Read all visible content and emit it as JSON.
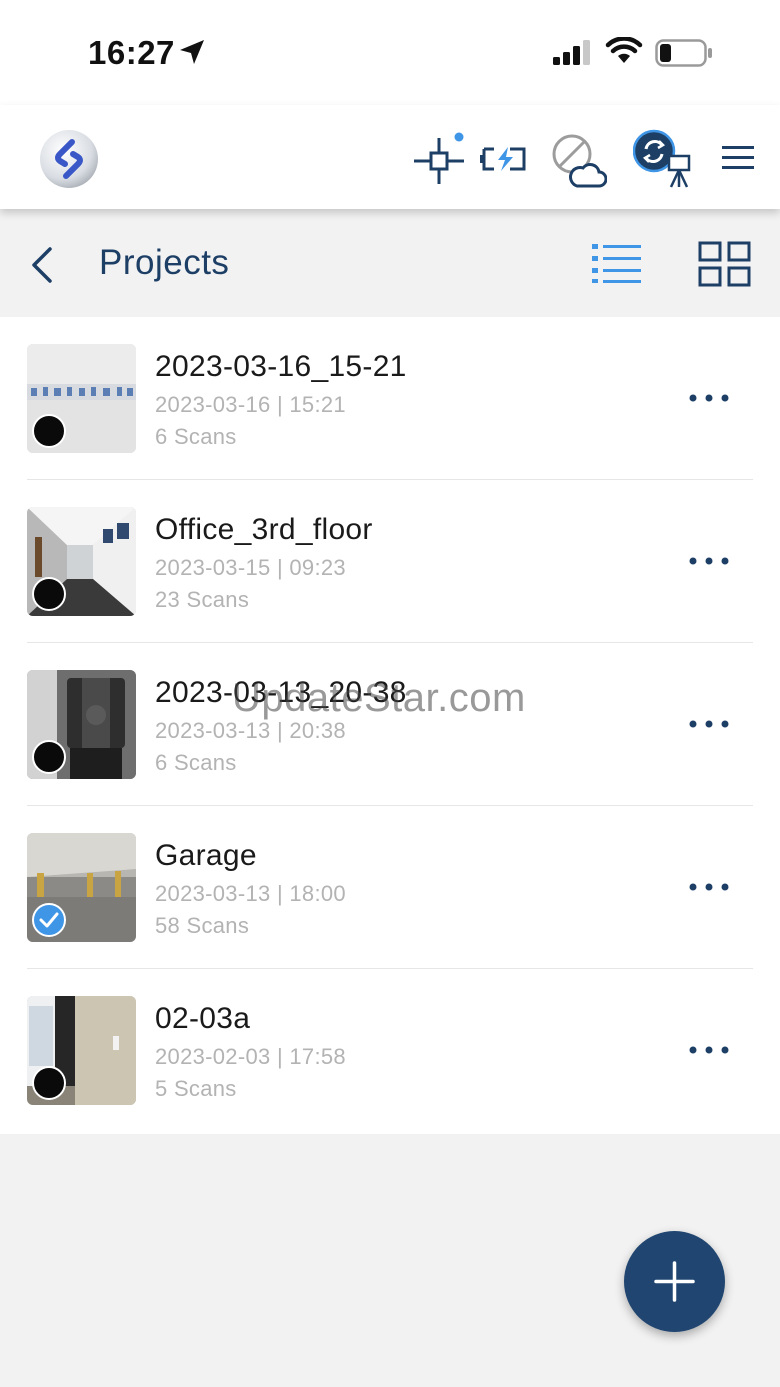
{
  "status_bar": {
    "time": "16:27"
  },
  "toolbar": {
    "icons": [
      "app-logo-icon",
      "scanner-position-icon",
      "battery-charging-icon",
      "cloud-offline-icon",
      "sync-scanner-icon",
      "menu-icon"
    ]
  },
  "header": {
    "title": "Projects"
  },
  "projects": [
    {
      "name": "2023-03-16_15-21",
      "date": "2023-03-16 | 15:21",
      "scans": "6 Scans",
      "selected": false
    },
    {
      "name": "Office_3rd_floor",
      "date": "2023-03-15 | 09:23",
      "scans": "23 Scans",
      "selected": false
    },
    {
      "name": "2023-03-13_20-38",
      "date": "2023-03-13 | 20:38",
      "scans": "6 Scans",
      "selected": false
    },
    {
      "name": "Garage",
      "date": "2023-03-13 | 18:00",
      "scans": "58 Scans",
      "selected": true
    },
    {
      "name": "02-03a",
      "date": "2023-02-03 | 17:58",
      "scans": "5 Scans",
      "selected": false
    }
  ],
  "watermark": "UpdateStar.com",
  "colors": {
    "accent": "#1f4570",
    "title": "#1d3f66",
    "list_view_active": "#3f95e6"
  }
}
